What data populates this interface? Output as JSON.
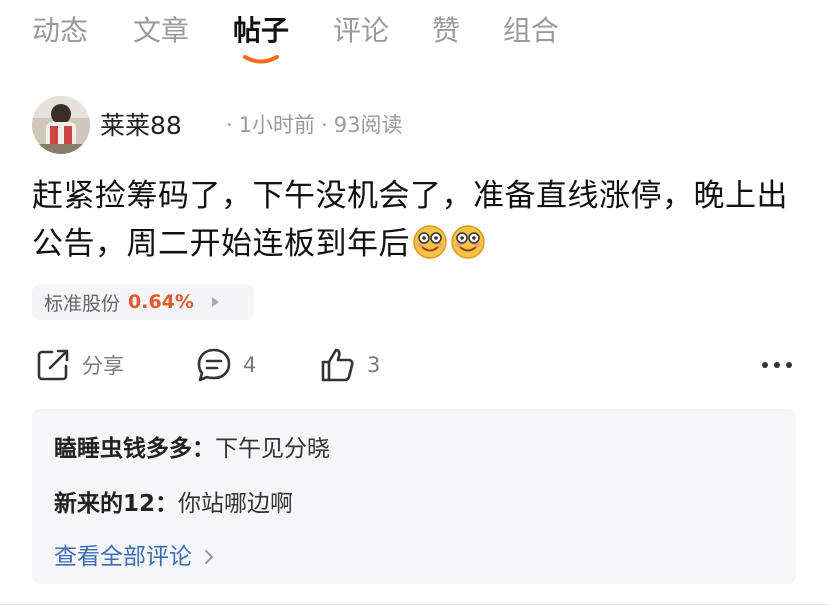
{
  "tabs": [
    {
      "label": "动态",
      "active": false
    },
    {
      "label": "文章",
      "active": false
    },
    {
      "label": "帖子",
      "active": true
    },
    {
      "label": "评论",
      "active": false
    },
    {
      "label": "赞",
      "active": false
    },
    {
      "label": "组合",
      "active": false
    }
  ],
  "post": {
    "author": "莱莱88",
    "time": "1小时前",
    "reads": "93阅读",
    "content": "赶紧捡筹码了，下午没机会了，准备直线涨停，晚上出公告，周二开始连板到年后",
    "emoji": "smiling-glasses-emoji",
    "stock": {
      "name": "标准股份",
      "change": "0.64%",
      "change_color": "#e05a2b"
    },
    "actions": {
      "share_label": "分享",
      "comment_count": "4",
      "like_count": "3"
    }
  },
  "comments": [
    {
      "author": "瞌睡虫钱多多",
      "separator": "：",
      "text": "下午见分晓"
    },
    {
      "author": "新来的12",
      "separator": "：",
      "text": "你站哪边啊"
    }
  ],
  "view_all_label": "查看全部评论",
  "colors": {
    "accent": "#ff6a1a",
    "link": "#3b6cb5"
  }
}
